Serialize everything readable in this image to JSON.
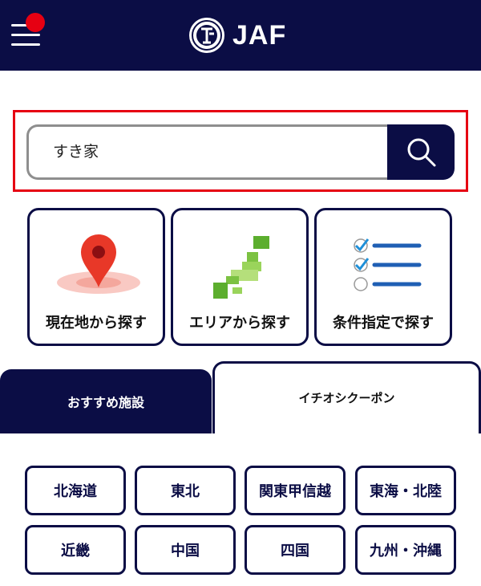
{
  "header": {
    "logo_text": "JAF",
    "menu_icon": "hamburger-icon",
    "notification": true
  },
  "search": {
    "value": "すき家",
    "button_icon": "search-icon"
  },
  "categories": [
    {
      "label": "現在地から探す",
      "icon": "map-pin-icon"
    },
    {
      "label": "エリアから探す",
      "icon": "japan-map-icon"
    },
    {
      "label": "条件指定で探す",
      "icon": "checklist-icon"
    }
  ],
  "tabs": [
    {
      "label": "おすすめ施設",
      "active": false
    },
    {
      "label": "イチオシクーポン",
      "active": true
    }
  ],
  "regions": [
    "北海道",
    "東北",
    "関東甲信越",
    "東海・北陸",
    "近畿",
    "中国",
    "四国",
    "九州・沖縄"
  ],
  "colors": {
    "navy": "#0b0d45",
    "accent_red": "#e60012",
    "green": "#7cc242",
    "blue": "#1f5fb4"
  }
}
